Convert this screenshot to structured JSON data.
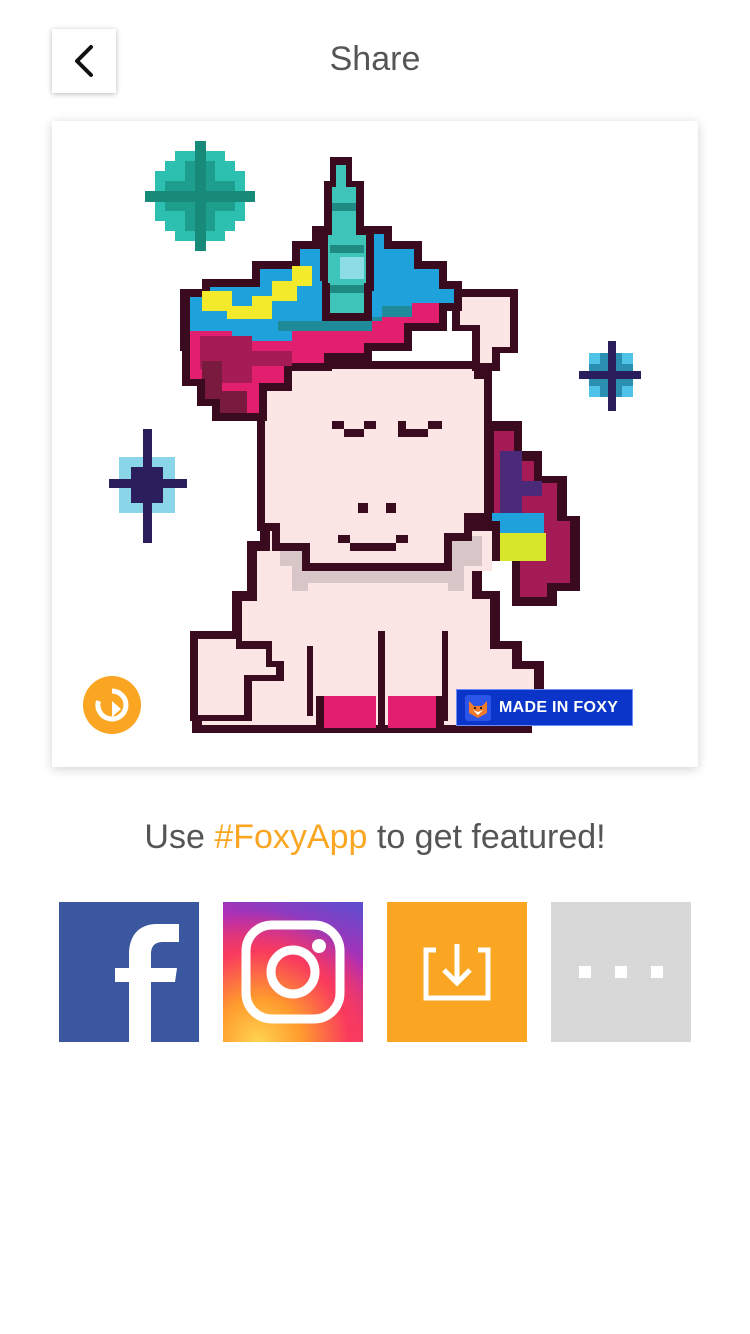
{
  "header": {
    "title": "Share",
    "back_icon": "chevron-left-icon"
  },
  "artwork": {
    "subject": "pixel-art unicorn",
    "replay_icon": "replay-icon",
    "watermark_text": "MADE IN FOXY"
  },
  "promo": {
    "prefix": "Use ",
    "hashtag": "#FoxyApp",
    "suffix": " to get featured!"
  },
  "share_buttons": [
    {
      "name": "facebook",
      "icon": "facebook-icon",
      "color": "#3B57A0"
    },
    {
      "name": "instagram",
      "icon": "instagram-icon",
      "color": "#E1306C"
    },
    {
      "name": "save",
      "icon": "download-icon",
      "color": "#FBA623"
    },
    {
      "name": "more",
      "icon": "more-icon",
      "color": "#D8D8D8"
    }
  ],
  "colors": {
    "accent": "#FBA623",
    "text": "#555555",
    "watermark_bg": "#0A35C8"
  }
}
